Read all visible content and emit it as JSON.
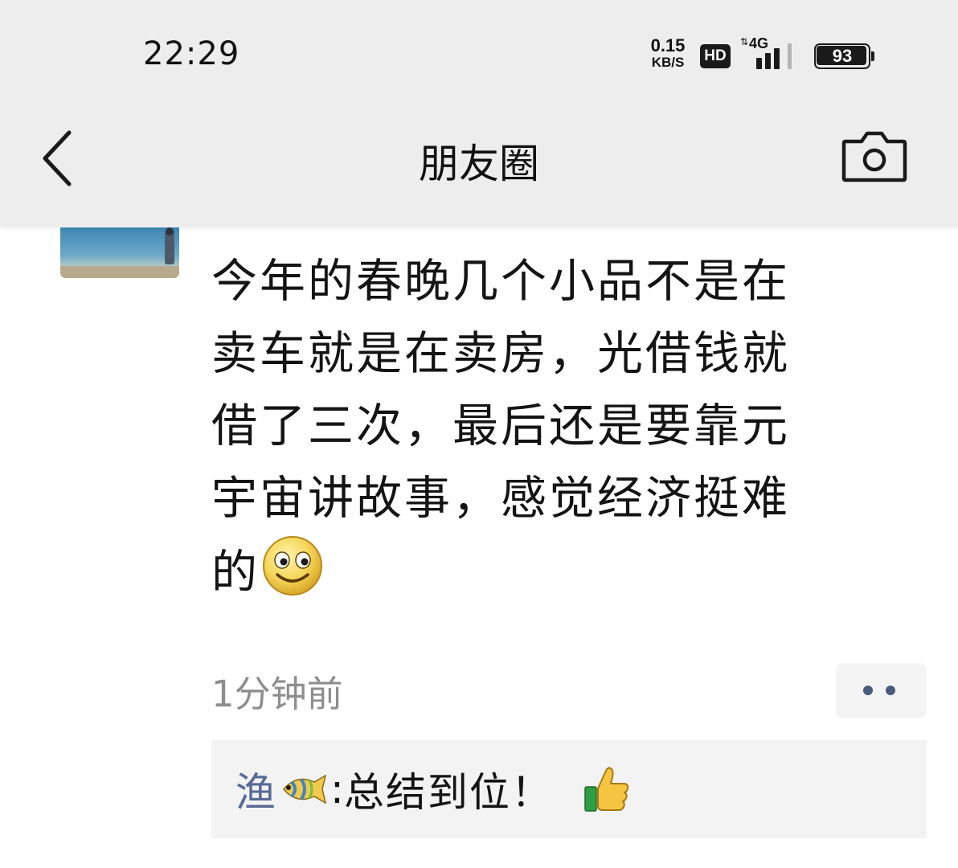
{
  "status_bar": {
    "time": "22:29",
    "net_speed_value": "0.15",
    "net_speed_unit": "KB/S",
    "hd_label": "HD",
    "network_label": "4G",
    "battery_level": "93"
  },
  "nav": {
    "back_icon": "chevron-left-icon",
    "title": "朋友圈",
    "camera_icon": "camera-icon"
  },
  "post": {
    "lines": [
      "今年的春晚几个小品不是在",
      "卖车就是在卖房，光借钱就",
      "借了三次，最后还是要靠元",
      "宇宙讲故事，感觉经济挺难",
      "的"
    ],
    "emoji": "smiley-icon",
    "time": "1分钟前",
    "more_icon": "more-dots-icon"
  },
  "comments": [
    {
      "author": "渔",
      "author_emoji": "fish-icon",
      "separator": ":",
      "text": "总结到位！",
      "emoji": "thumbs-up-icon"
    }
  ],
  "colors": {
    "header_bg": "#ededed",
    "link_blue": "#576b95",
    "meta_gray": "#8e8e8e",
    "comment_bg": "#f3f3f3"
  }
}
